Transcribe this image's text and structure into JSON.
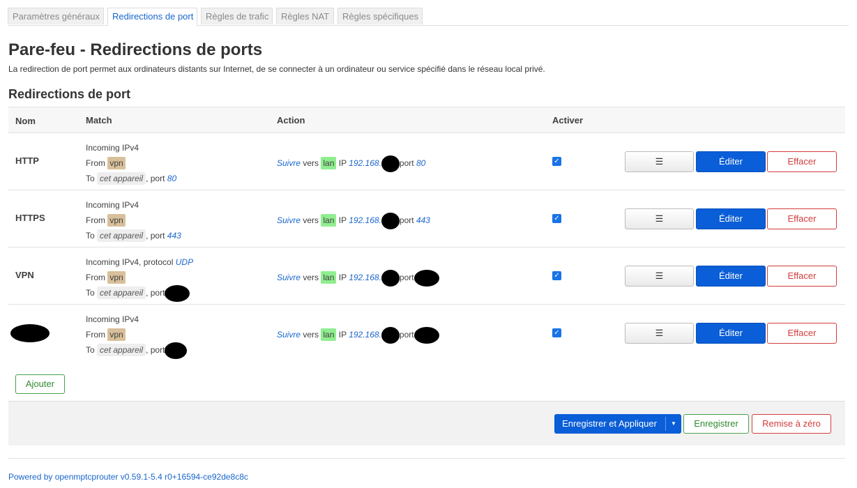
{
  "tabs": [
    {
      "label": "Paramètres généraux"
    },
    {
      "label": "Redirections de port"
    },
    {
      "label": "Règles de trafic"
    },
    {
      "label": "Règles NAT"
    },
    {
      "label": "Règles spécifiques"
    }
  ],
  "page": {
    "title": "Pare-feu - Redirections de ports",
    "description": "La redirection de port permet aux ordinateurs distants sur Internet, de se connecter à un ordinateur ou service spécifié dans le réseau local privé.",
    "section_title": "Redirections de port"
  },
  "table": {
    "headers": {
      "name": "Nom",
      "match": "Match",
      "action": "Action",
      "enable": "Activer"
    },
    "rows": [
      {
        "name": "HTTP",
        "incoming": "Incoming IPv4",
        "protocol": "",
        "from_zone": "vpn",
        "to_device": "cet appareil",
        "dest_port": "80",
        "action_verb": "Suivre",
        "target_zone": "lan",
        "target_ip": "192.168.",
        "forward_port": "80",
        "enabled": true
      },
      {
        "name": "HTTPS",
        "incoming": "Incoming IPv4",
        "protocol": "",
        "from_zone": "vpn",
        "to_device": "cet appareil",
        "dest_port": "443",
        "action_verb": "Suivre",
        "target_zone": "lan",
        "target_ip": "192.168.",
        "forward_port": "443",
        "enabled": true
      },
      {
        "name": "VPN",
        "incoming": "Incoming IPv4, protocol",
        "protocol": "UDP",
        "from_zone": "vpn",
        "to_device": "cet appareil",
        "dest_port": "",
        "action_verb": "Suivre",
        "target_zone": "lan",
        "target_ip": "192.168.",
        "forward_port": "",
        "enabled": true
      },
      {
        "name": "",
        "incoming": "Incoming IPv4",
        "protocol": "",
        "from_zone": "vpn",
        "to_device": "cet appareil",
        "dest_port": "",
        "action_verb": "Suivre",
        "target_zone": "lan",
        "target_ip": "192.168.",
        "forward_port": "",
        "enabled": true
      }
    ],
    "labels": {
      "from": "From",
      "to": "To",
      "port": "port",
      "vers": "vers",
      "ip": "IP"
    },
    "buttons": {
      "sort": "☰",
      "edit": "Éditer",
      "delete": "Effacer"
    }
  },
  "add_label": "Ajouter",
  "footer": {
    "save_apply": "Enregistrer et Appliquer",
    "save": "Enregistrer",
    "reset": "Remise à zéro"
  },
  "powered_by": "Powered by openmptcprouter v0.59.1-5.4 r0+16594-ce92de8c8c",
  "colors": {
    "accent": "#0a5ed7",
    "danger": "#d33c3c",
    "success": "#4aa04a",
    "zone_vpn": "#d8c09a",
    "zone_lan": "#90ee90"
  }
}
